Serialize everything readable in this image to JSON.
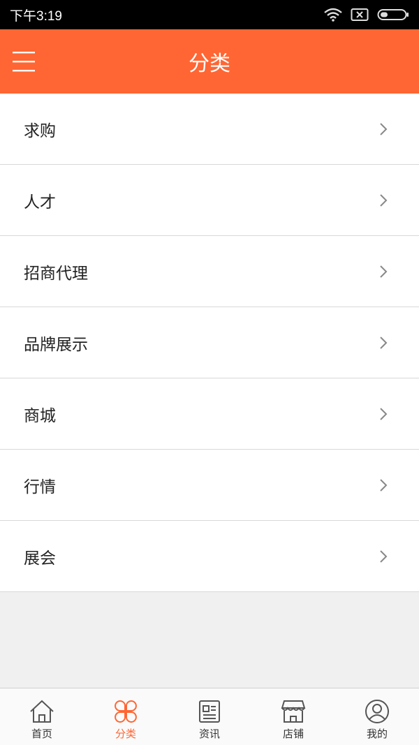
{
  "status_bar": {
    "time": "下午3:19"
  },
  "header": {
    "title": "分类"
  },
  "categories": [
    {
      "label": "求购"
    },
    {
      "label": "人才"
    },
    {
      "label": "招商代理"
    },
    {
      "label": "品牌展示"
    },
    {
      "label": "商城"
    },
    {
      "label": "行情"
    },
    {
      "label": "展会"
    }
  ],
  "tabs": [
    {
      "label": "首页",
      "icon": "home-icon"
    },
    {
      "label": "分类",
      "icon": "clover-icon",
      "active": true
    },
    {
      "label": "资讯",
      "icon": "news-icon"
    },
    {
      "label": "店铺",
      "icon": "store-icon"
    },
    {
      "label": "我的",
      "icon": "user-icon"
    }
  ],
  "colors": {
    "accent": "#ff6633",
    "inactive_icon": "#555555"
  }
}
